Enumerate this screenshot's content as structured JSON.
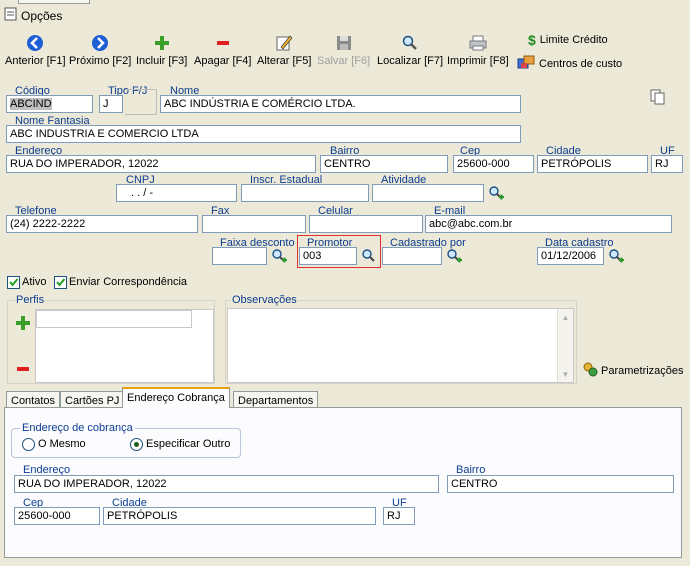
{
  "menu": {
    "options_label": "Opções"
  },
  "toolbar": {
    "prev": "Anterior [F1]",
    "next": "Próximo [F2]",
    "add": "Incluir [F3]",
    "delete": "Apagar [F4]",
    "edit": "Alterar [F5]",
    "save": "Salvar [F6]",
    "find": "Localizar [F7]",
    "print": "Imprimir [F8]",
    "credit_limit": "Limite Crédito",
    "cost_centers": "Centros de custo"
  },
  "form": {
    "codigo": {
      "label": "Código",
      "value": "ABCIND"
    },
    "tipo": {
      "label": "Tipo F/J",
      "value": "J"
    },
    "nome": {
      "label": "Nome",
      "value": "ABC INDÚSTRIA E COMÉRCIO LTDA."
    },
    "fantasia": {
      "label": "Nome Fantasia",
      "value": "ABC INDUSTRIA E COMERCIO LTDA"
    },
    "endereco": {
      "label": "Endereço",
      "value": "RUA DO IMPERADOR, 12022"
    },
    "bairro": {
      "label": "Bairro",
      "value": "CENTRO"
    },
    "cep": {
      "label": "Cep",
      "value": "25600-000"
    },
    "cidade": {
      "label": "Cidade",
      "value": "PETRÓPOLIS"
    },
    "uf": {
      "label": "UF",
      "value": "RJ"
    },
    "cnpj": {
      "label": "CNPJ",
      "value": ".   .   /   -"
    },
    "inscr": {
      "label": "Inscr. Estadual",
      "value": ""
    },
    "atividade": {
      "label": "Atividade",
      "value": ""
    },
    "telefone": {
      "label": "Telefone",
      "value": "(24) 2222-2222"
    },
    "fax": {
      "label": "Fax",
      "value": ""
    },
    "celular": {
      "label": "Celular",
      "value": ""
    },
    "email": {
      "label": "E-mail",
      "value": "abc@abc.com.br"
    },
    "faixa": {
      "label": "Faixa desconto",
      "value": ""
    },
    "promotor": {
      "label": "Promotor",
      "value": "003"
    },
    "cadastrado": {
      "label": "Cadastrado por",
      "value": ""
    },
    "data_cadastro": {
      "label": "Data cadastro",
      "value": "01/12/2006"
    },
    "ativo": {
      "label": "Ativo",
      "checked": true
    },
    "enviar": {
      "label": "Enviar Correspondência",
      "checked": true
    },
    "perfis": {
      "label": "Perfis"
    },
    "observacoes": {
      "label": "Observações"
    },
    "parametrizacoes": "Parametrizações"
  },
  "tabs": [
    "Contatos",
    "Cartões PJ",
    "Endereço Cobrança",
    "Departamentos"
  ],
  "billing": {
    "group_label": "Endereço de cobrança",
    "opt_same": "O Mesmo",
    "opt_other": "Especificar Outro",
    "selected": "Especificar Outro",
    "endereco": {
      "label": "Endereço",
      "value": "RUA DO IMPERADOR, 12022"
    },
    "bairro": {
      "label": "Bairro",
      "value": "CENTRO"
    },
    "cep": {
      "label": "Cep",
      "value": "25600-000"
    },
    "cidade": {
      "label": "Cidade",
      "value": "PETRÓPOLIS"
    },
    "uf": {
      "label": "UF",
      "value": "RJ"
    }
  },
  "colors": {
    "label": "#0b3d91",
    "highlight": "#e03030",
    "tab_accent": "#e6a016"
  }
}
